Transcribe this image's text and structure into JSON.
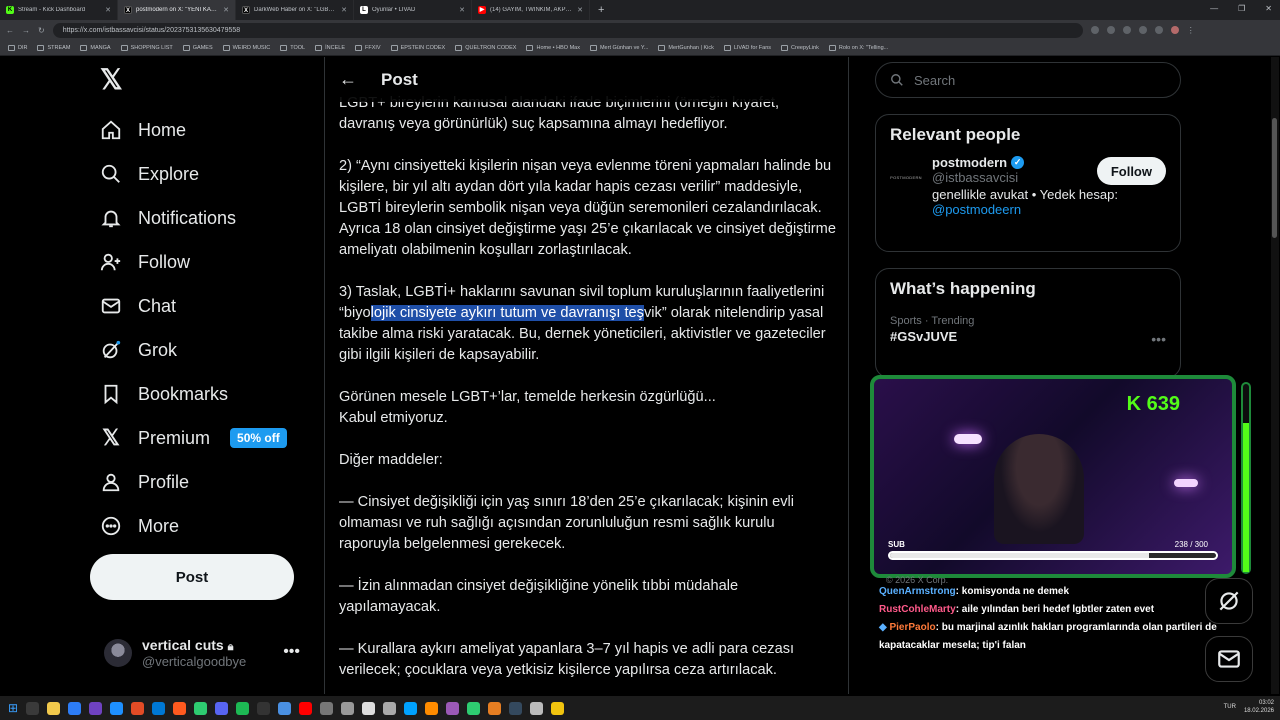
{
  "browser": {
    "tabs": [
      {
        "title": "Stream - Kick Dashboard",
        "color": "#53fc18",
        "glyph": "K"
      },
      {
        "title": "postmodern on X: \"YENİ KANUN T",
        "color": "#000000",
        "glyph": "X",
        "active": true
      },
      {
        "title": "DarkWeb Haber on X: \"LGBT'yi de",
        "color": "#000000",
        "glyph": "X"
      },
      {
        "title": "Oyunlar • LIVAD",
        "color": "#ffffff",
        "glyph": "L"
      },
      {
        "title": "(14) GAYIM, TWINKIM, AKPLİYİM",
        "color": "#ff0000",
        "glyph": "▶"
      }
    ],
    "new_tab": "+",
    "url": "https://x.com/istbassavcisi/status/2023753135630479558",
    "bookmarks": [
      "DIR",
      "STREAM",
      "MANGA",
      "SHOPPING LIST",
      "GAMES",
      "WEIRD MUSIC",
      "TOOL",
      "İNCELE",
      "FFXIV",
      "EPSTEIN CODEX",
      "QUELTRON CODEX",
      "Home • HBO Max",
      "Mert Günhan ve Y...",
      "MertGunhan | Kick",
      "LIVAD for Fans",
      "CreepyLink",
      "Rolo on X: \"Telling..."
    ]
  },
  "x": {
    "nav": [
      {
        "key": "home",
        "label": "Home"
      },
      {
        "key": "explore",
        "label": "Explore"
      },
      {
        "key": "notifications",
        "label": "Notifications"
      },
      {
        "key": "follow",
        "label": "Follow"
      },
      {
        "key": "chat",
        "label": "Chat"
      },
      {
        "key": "grok",
        "label": "Grok"
      },
      {
        "key": "bookmarks",
        "label": "Bookmarks"
      },
      {
        "key": "premium",
        "label": "Premium"
      },
      {
        "key": "profile",
        "label": "Profile"
      },
      {
        "key": "more",
        "label": "More"
      }
    ],
    "premium_badge": "50% off",
    "post_button": "Post",
    "account": {
      "name": "vertical cuts",
      "handle": "@verticalgoodbye"
    },
    "header_title": "Post",
    "post": {
      "p0": "LGBT+ bireylerin kamusal alandaki ifade biçimlerini (örneğin kıyafet, davranış veya görünürlük) suç kapsamına almayı hedefliyor.",
      "p1": "2) “Aynı cinsiyetteki kişilerin nişan veya evlenme töreni yapmaları halinde bu kişilere, bir yıl altı aydan dört yıla kadar hapis cezası verilir” maddesiyle, LGBTİ bireylerin sembolik nişan veya düğün seremonileri cezalandırılacak. Ayrıca 18 olan cinsiyet değiştirme yaşı 25’e çıkarılacak ve cinsiyet değiştirme ameliyatı olabilmenin koşulları zorlaştırılacak.",
      "p2_before": "3) Taslak, LGBTİ+ haklarını savunan sivil toplum kuruluşlarının faaliyetlerini “biyo",
      "p2_highlight": "lojik cinsiyete aykırı tutum ve davranışı teş",
      "p2_after": "vik” olarak nitelendirip yasal takibe alma riski yaratacak. Bu, dernek yöneticileri, aktivistler ve gazeteciler gibi ilgili kişileri de kapsayabilir.",
      "p3": "Görünen mesele LGBT+’lar, temelde herkesin özgürlüğü...\nKabul etmiyoruz.",
      "p4": "Diğer maddeler:",
      "p5": "— Cinsiyet değişikliği için yaş sınırı 18’den 25’e çıkarılacak; kişinin evli olmaması ve ruh sağlığı açısından zorunluluğun resmi sağlık kurulu raporuyla belgelenmesi gerekecek.",
      "p6": "— İzin alınmadan cinsiyet değişikliğine yönelik tıbbi müdahale yapılamayacak.",
      "p7": "— Kurallara aykırı ameliyat yapanlara 3–7 yıl hapis ve adli para cezası verilecek; çocuklara veya yetkisiz kişilerce yapılırsa ceza artırılacak."
    },
    "search_placeholder": "Search",
    "relevant": {
      "title": "Relevant people",
      "avatar_text": "POSTMODERN",
      "name": "postmodern",
      "handle": "@istbassavcisi",
      "bio": "genellikle avukat • Yedek hesap:",
      "bio_link": "@postmodeern",
      "follow": "Follow"
    },
    "happening": {
      "title": "What’s happening",
      "meta": "Sports · Trending",
      "tag": "#GSvJUVE"
    },
    "copyright": "© 2026 X Corp."
  },
  "stream_overlay": {
    "kick_count": "639",
    "sub_label": "SUB",
    "sub_current": 238,
    "sub_goal": 300,
    "sub_text": "238 / 300",
    "accent": "#53fc18"
  },
  "chat": [
    {
      "user": "QuenArmstrong",
      "msg": ": komisyonda ne demek"
    },
    {
      "user": "RustCohleMarty",
      "msg": ": aile yılından beri hedef lgbtler zaten evet"
    },
    {
      "user": "PierPaolo",
      "msg": ": bu marjinal azınlık hakları programlarında olan partileri de kapatacaklar mesela; tip'i falan"
    }
  ],
  "taskbar": {
    "lang": "TUR",
    "time": "03:02",
    "date": "18.02.2026"
  }
}
